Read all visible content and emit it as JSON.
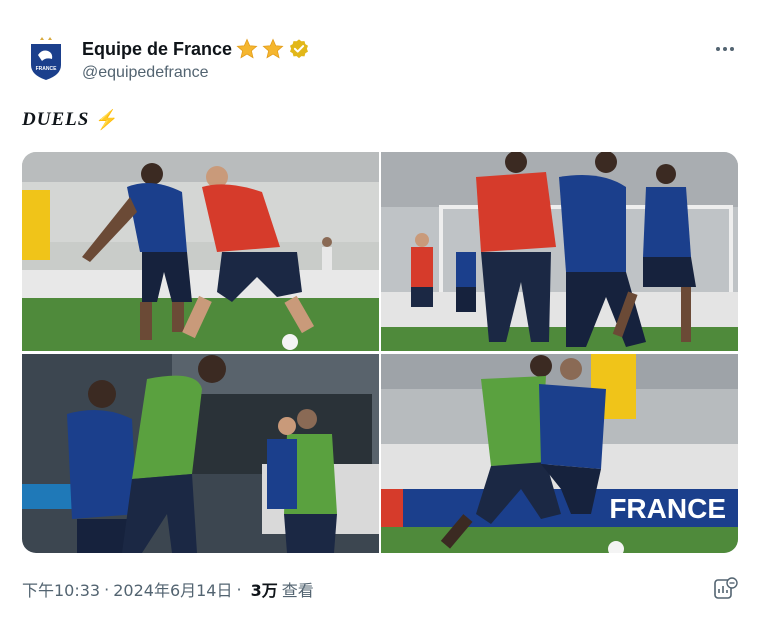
{
  "account": {
    "display_name": "Equipe de France",
    "handle": "@equipedefrance",
    "avatar_text": "FRANCE",
    "star_color": "#f5b62f",
    "verified_color": "#e2b719"
  },
  "tweet": {
    "text": "DUELS",
    "emoji": "⚡"
  },
  "media": {
    "count": 4,
    "photos": [
      "photo-1",
      "photo-2",
      "photo-3",
      "photo-4"
    ]
  },
  "meta": {
    "time": "下午10:33",
    "date": "2024年6月14日",
    "separator": "·",
    "views_count": "3万",
    "views_label": "查看"
  },
  "colors": {
    "text_primary": "#0f1419",
    "text_secondary": "#536471",
    "france_blue": "#1b3f8c",
    "pitch_green": "#4f8a3b"
  }
}
